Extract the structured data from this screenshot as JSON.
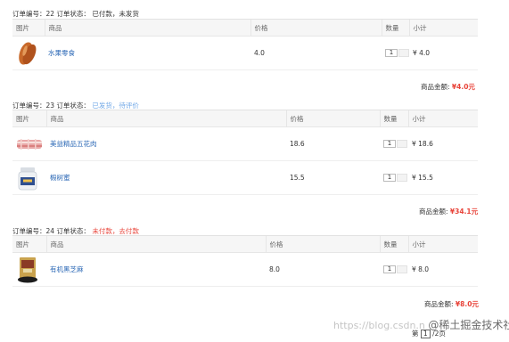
{
  "columns": {
    "image": "图片",
    "product": "商品",
    "price": "价格",
    "qty": "数量",
    "subtotal": "小计"
  },
  "orders": [
    {
      "id_label": "订单编号：22",
      "status_label": "订单状态：",
      "status": "已付款，未发货",
      "items": [
        {
          "image": "sweet-potato",
          "name": "水果零食",
          "price": "4.0",
          "qty": "1",
          "subtotal": "¥ 4.0"
        }
      ],
      "total_label": "商品金额:",
      "total": "¥4.0元"
    },
    {
      "id_label": "订单编号：23",
      "status_label": "订单状态：",
      "status": "已发货，待评价",
      "items": [
        {
          "image": "pork-belly",
          "name": "美益精品五花肉",
          "price": "18.6",
          "qty": "1",
          "subtotal": "¥ 18.6"
        },
        {
          "image": "honey-jar",
          "name": "椴树蜜",
          "price": "15.5",
          "qty": "1",
          "subtotal": "¥ 15.5"
        }
      ],
      "total_label": "商品金额:",
      "total": "¥34.1元"
    },
    {
      "id_label": "订单编号：24",
      "status_label": "订单状态：",
      "status": "未付款，去付款",
      "items": [
        {
          "image": "sesame-bag",
          "name": "有机黑芝麻",
          "price": "8.0",
          "qty": "1",
          "subtotal": "¥ 8.0"
        }
      ],
      "total_label": "商品金额:",
      "total": "¥8.0元"
    }
  ],
  "pager": {
    "prefix": "第",
    "current": "1",
    "suffix": "/2页"
  },
  "watermark": {
    "url": "https://blog.csdn.n",
    "brand": "@稀土掘金技术社区"
  },
  "colors": {
    "link": "#2a67b5",
    "status_blue": "#6ea6e6",
    "status_red": "#e8443a",
    "price_red": "#e8443a"
  }
}
